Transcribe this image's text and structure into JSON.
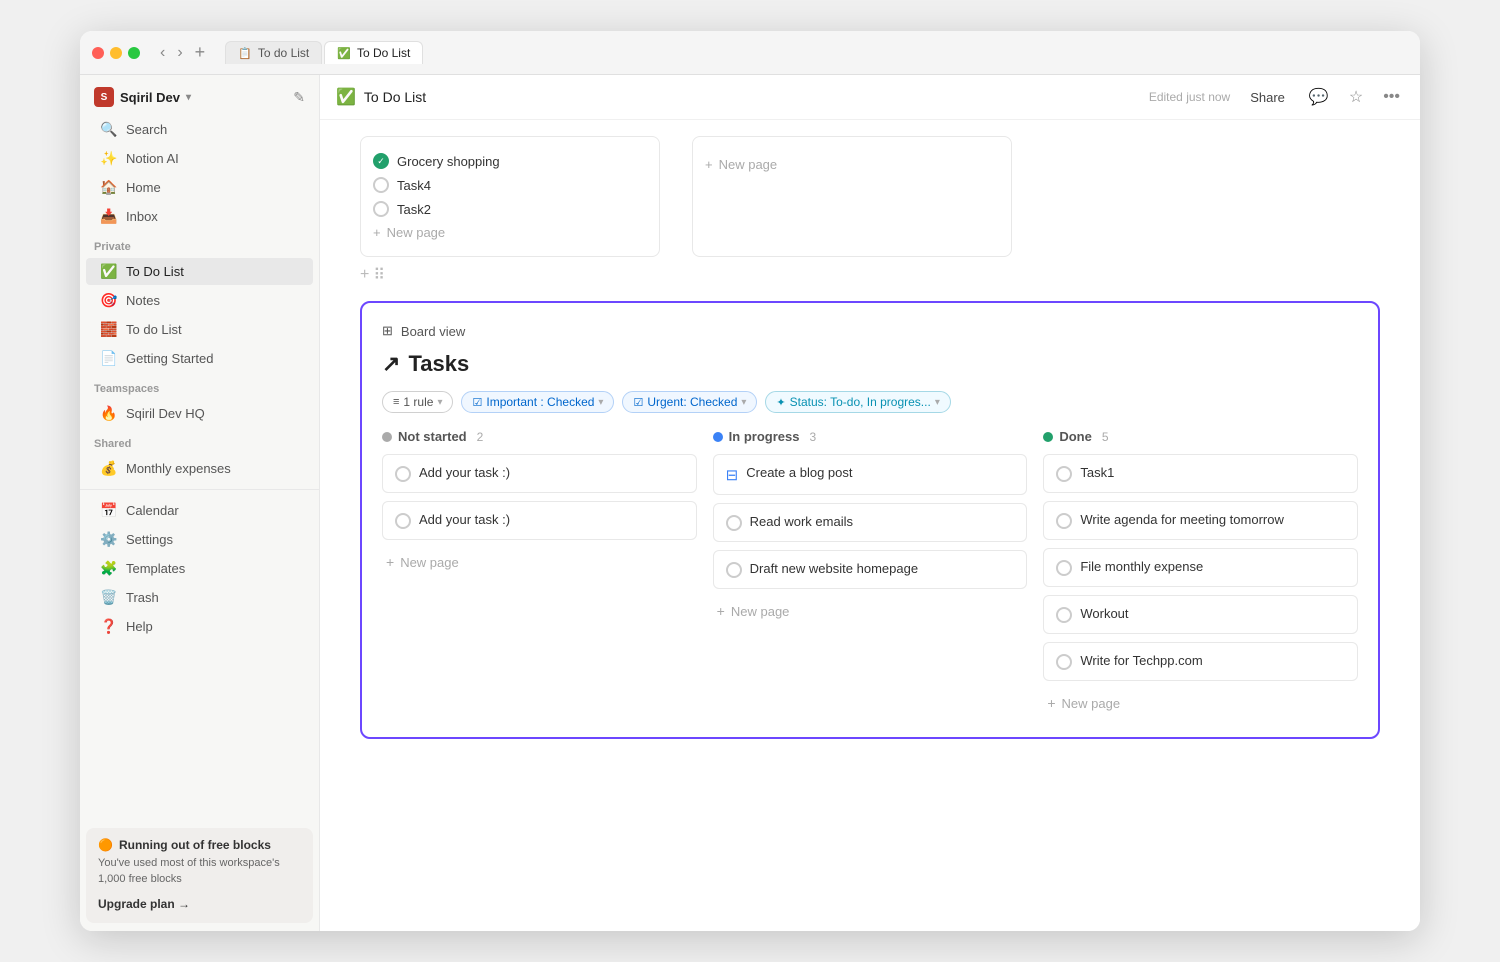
{
  "window": {
    "tabs": [
      {
        "id": "tab1",
        "label": "To do List",
        "icon": "📋",
        "active": false
      },
      {
        "id": "tab2",
        "label": "To Do List",
        "icon": "✅",
        "active": true
      }
    ]
  },
  "sidebar": {
    "workspace": {
      "name": "Sqiril Dev",
      "avatar": "S"
    },
    "nav": [
      {
        "id": "search",
        "label": "Search",
        "icon": "🔍"
      },
      {
        "id": "notion-ai",
        "label": "Notion AI",
        "icon": "✨"
      },
      {
        "id": "home",
        "label": "Home",
        "icon": "🏠"
      },
      {
        "id": "inbox",
        "label": "Inbox",
        "icon": "📥"
      }
    ],
    "private_section": "Private",
    "private_items": [
      {
        "id": "todo-list",
        "label": "To Do List",
        "icon": "✅",
        "active": true
      },
      {
        "id": "notes",
        "label": "Notes",
        "icon": "🎯"
      },
      {
        "id": "todo-list-2",
        "label": "To do List",
        "icon": "🧱"
      },
      {
        "id": "getting-started",
        "label": "Getting Started",
        "icon": "📄"
      }
    ],
    "teamspaces_section": "Teamspaces",
    "teamspaces_items": [
      {
        "id": "sqiril-hq",
        "label": "Sqiril Dev HQ",
        "icon": "🔥"
      }
    ],
    "shared_section": "Shared",
    "shared_items": [
      {
        "id": "monthly-expenses",
        "label": "Monthly expenses",
        "icon": "💰"
      }
    ],
    "tools": [
      {
        "id": "calendar",
        "label": "Calendar",
        "icon": "📅"
      },
      {
        "id": "settings",
        "label": "Settings",
        "icon": "⚙️"
      },
      {
        "id": "templates",
        "label": "Templates",
        "icon": "🧩"
      },
      {
        "id": "trash",
        "label": "Trash",
        "icon": "🗑️"
      },
      {
        "id": "help",
        "label": "Help",
        "icon": "❓"
      }
    ],
    "upgrade": {
      "title": "Running out of free blocks",
      "desc": "You've used most of this workspace's 1,000 free blocks",
      "link": "Upgrade plan →"
    }
  },
  "header": {
    "page_title": "To Do List",
    "edited_text": "Edited just now",
    "share_label": "Share"
  },
  "top_cards": [
    {
      "items": [
        {
          "label": "Grocery shopping",
          "checked": true
        },
        {
          "label": "Task4",
          "checked": false
        },
        {
          "label": "Task2",
          "checked": false
        }
      ],
      "new_page": "New page"
    },
    {
      "new_page": "New page"
    }
  ],
  "board": {
    "view_label": "Board view",
    "title": "Tasks",
    "title_icon": "↗",
    "filters": [
      {
        "id": "rule",
        "label": "1 rule",
        "icon": "≡",
        "type": "default"
      },
      {
        "id": "important",
        "label": "Important : Checked",
        "icon": "☑",
        "type": "blue"
      },
      {
        "id": "urgent",
        "label": "Urgent: Checked",
        "icon": "☑",
        "type": "blue"
      },
      {
        "id": "status",
        "label": "Status: To-do, In progres...",
        "icon": "✦",
        "type": "teal"
      }
    ],
    "columns": [
      {
        "id": "not-started",
        "label": "Not started",
        "dot": "gray",
        "count": 2,
        "tasks": [
          {
            "label": "Add your task :)",
            "icon": "circle"
          },
          {
            "label": "Add your task :)",
            "icon": "circle"
          }
        ],
        "new_page": "New page"
      },
      {
        "id": "in-progress",
        "label": "In progress",
        "dot": "blue",
        "count": 3,
        "tasks": [
          {
            "label": "Create a blog post",
            "icon": "progress"
          },
          {
            "label": "Read work emails",
            "icon": "circle"
          },
          {
            "label": "Draft new website homepage",
            "icon": "circle"
          }
        ],
        "new_page": "New page"
      },
      {
        "id": "done",
        "label": "Done",
        "dot": "green",
        "count": 5,
        "tasks": [
          {
            "label": "Task1",
            "icon": "circle"
          },
          {
            "label": "Write agenda for meeting tomorrow",
            "icon": "circle"
          },
          {
            "label": "File monthly expense",
            "icon": "circle"
          },
          {
            "label": "Workout",
            "icon": "circle"
          },
          {
            "label": "Write for Techpp.com",
            "icon": "circle"
          }
        ],
        "new_page": "New page"
      }
    ]
  }
}
